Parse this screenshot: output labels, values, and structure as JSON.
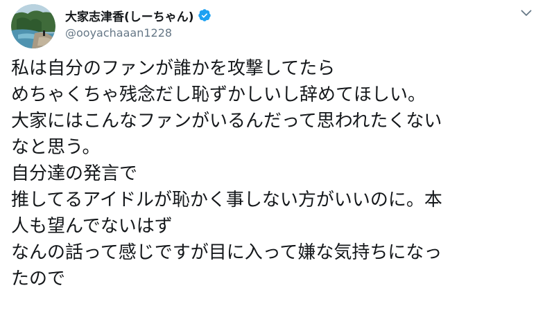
{
  "author": {
    "display_name": "大家志津香(しーちゃん)",
    "handle": "@ooyachaaan1228",
    "avatar_icon": "profile-photo-coast",
    "verified_icon": "verified-badge-icon"
  },
  "menu": {
    "icon": "chevron-down-icon"
  },
  "tweet": {
    "lines": [
      "私は自分のファンが誰かを攻撃してたら",
      "めちゃくちゃ残念だし恥ずかしいし辞めてほしい。",
      "大家にはこんなファンがいるんだって思われたくない",
      "なと思う。",
      "自分達の発言で",
      "推してるアイドルが恥かく事しない方がいいのに。本",
      "人も望んでないはず",
      "なんの話って感じですが目に入って嫌な気持ちになっ",
      "たので"
    ]
  },
  "colors": {
    "text": "#14171a",
    "secondary_text": "#657786",
    "verified": "#1da1f2"
  }
}
